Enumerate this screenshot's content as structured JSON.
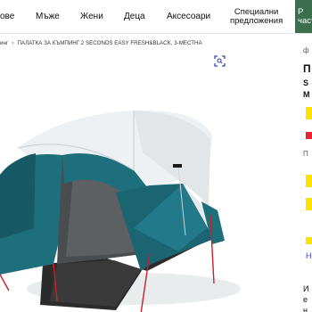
{
  "nav": {
    "items": [
      {
        "label": "ове"
      },
      {
        "label": "Мъже"
      },
      {
        "label": "Жени"
      },
      {
        "label": "Деца"
      },
      {
        "label": "Аксесоари"
      }
    ],
    "special": {
      "line1": "Специални",
      "line2": "предложения"
    },
    "cta": {
      "line1": "Р",
      "line2": "частн"
    }
  },
  "breadcrumb": {
    "items": [
      "инг",
      "ПАЛАТКА ЗА КЪМПИНГ 2 SECONDS EASY FRESH&BLACK, 3-МЕСТНА"
    ]
  },
  "gallery": {
    "zoom_icon": "expand-icon",
    "image": "tent-product-photo"
  },
  "right_column": {
    "lines": [
      "ф",
      "П",
      "S",
      "М"
    ],
    "pr_label": "П",
    "link_char": "Н",
    "bottom": [
      "И",
      "е",
      "н"
    ]
  },
  "colors": {
    "accent_green": "#3b6e4d",
    "price_yellow": "#ffe100",
    "promo_red": "#e3262f",
    "link_blue": "#3643ba",
    "tent_teal": "#1e6f7c"
  }
}
